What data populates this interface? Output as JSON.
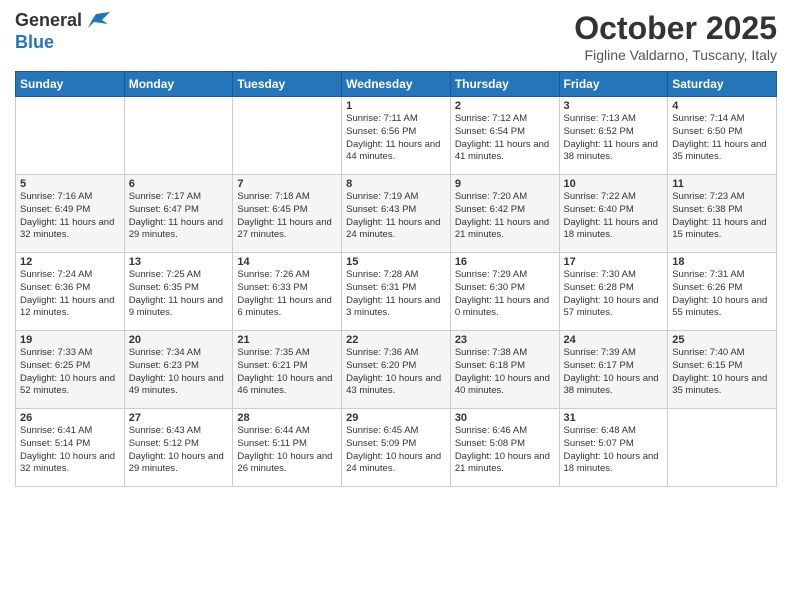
{
  "header": {
    "logo_line1": "General",
    "logo_line2": "Blue",
    "month_title": "October 2025",
    "location": "Figline Valdarno, Tuscany, Italy"
  },
  "days_of_week": [
    "Sunday",
    "Monday",
    "Tuesday",
    "Wednesday",
    "Thursday",
    "Friday",
    "Saturday"
  ],
  "weeks": [
    {
      "days": [
        {
          "num": "",
          "content": ""
        },
        {
          "num": "",
          "content": ""
        },
        {
          "num": "",
          "content": ""
        },
        {
          "num": "1",
          "content": "Sunrise: 7:11 AM\nSunset: 6:56 PM\nDaylight: 11 hours and 44 minutes."
        },
        {
          "num": "2",
          "content": "Sunrise: 7:12 AM\nSunset: 6:54 PM\nDaylight: 11 hours and 41 minutes."
        },
        {
          "num": "3",
          "content": "Sunrise: 7:13 AM\nSunset: 6:52 PM\nDaylight: 11 hours and 38 minutes."
        },
        {
          "num": "4",
          "content": "Sunrise: 7:14 AM\nSunset: 6:50 PM\nDaylight: 11 hours and 35 minutes."
        }
      ]
    },
    {
      "days": [
        {
          "num": "5",
          "content": "Sunrise: 7:16 AM\nSunset: 6:49 PM\nDaylight: 11 hours and 32 minutes."
        },
        {
          "num": "6",
          "content": "Sunrise: 7:17 AM\nSunset: 6:47 PM\nDaylight: 11 hours and 29 minutes."
        },
        {
          "num": "7",
          "content": "Sunrise: 7:18 AM\nSunset: 6:45 PM\nDaylight: 11 hours and 27 minutes."
        },
        {
          "num": "8",
          "content": "Sunrise: 7:19 AM\nSunset: 6:43 PM\nDaylight: 11 hours and 24 minutes."
        },
        {
          "num": "9",
          "content": "Sunrise: 7:20 AM\nSunset: 6:42 PM\nDaylight: 11 hours and 21 minutes."
        },
        {
          "num": "10",
          "content": "Sunrise: 7:22 AM\nSunset: 6:40 PM\nDaylight: 11 hours and 18 minutes."
        },
        {
          "num": "11",
          "content": "Sunrise: 7:23 AM\nSunset: 6:38 PM\nDaylight: 11 hours and 15 minutes."
        }
      ]
    },
    {
      "days": [
        {
          "num": "12",
          "content": "Sunrise: 7:24 AM\nSunset: 6:36 PM\nDaylight: 11 hours and 12 minutes."
        },
        {
          "num": "13",
          "content": "Sunrise: 7:25 AM\nSunset: 6:35 PM\nDaylight: 11 hours and 9 minutes."
        },
        {
          "num": "14",
          "content": "Sunrise: 7:26 AM\nSunset: 6:33 PM\nDaylight: 11 hours and 6 minutes."
        },
        {
          "num": "15",
          "content": "Sunrise: 7:28 AM\nSunset: 6:31 PM\nDaylight: 11 hours and 3 minutes."
        },
        {
          "num": "16",
          "content": "Sunrise: 7:29 AM\nSunset: 6:30 PM\nDaylight: 11 hours and 0 minutes."
        },
        {
          "num": "17",
          "content": "Sunrise: 7:30 AM\nSunset: 6:28 PM\nDaylight: 10 hours and 57 minutes."
        },
        {
          "num": "18",
          "content": "Sunrise: 7:31 AM\nSunset: 6:26 PM\nDaylight: 10 hours and 55 minutes."
        }
      ]
    },
    {
      "days": [
        {
          "num": "19",
          "content": "Sunrise: 7:33 AM\nSunset: 6:25 PM\nDaylight: 10 hours and 52 minutes."
        },
        {
          "num": "20",
          "content": "Sunrise: 7:34 AM\nSunset: 6:23 PM\nDaylight: 10 hours and 49 minutes."
        },
        {
          "num": "21",
          "content": "Sunrise: 7:35 AM\nSunset: 6:21 PM\nDaylight: 10 hours and 46 minutes."
        },
        {
          "num": "22",
          "content": "Sunrise: 7:36 AM\nSunset: 6:20 PM\nDaylight: 10 hours and 43 minutes."
        },
        {
          "num": "23",
          "content": "Sunrise: 7:38 AM\nSunset: 6:18 PM\nDaylight: 10 hours and 40 minutes."
        },
        {
          "num": "24",
          "content": "Sunrise: 7:39 AM\nSunset: 6:17 PM\nDaylight: 10 hours and 38 minutes."
        },
        {
          "num": "25",
          "content": "Sunrise: 7:40 AM\nSunset: 6:15 PM\nDaylight: 10 hours and 35 minutes."
        }
      ]
    },
    {
      "days": [
        {
          "num": "26",
          "content": "Sunrise: 6:41 AM\nSunset: 5:14 PM\nDaylight: 10 hours and 32 minutes."
        },
        {
          "num": "27",
          "content": "Sunrise: 6:43 AM\nSunset: 5:12 PM\nDaylight: 10 hours and 29 minutes."
        },
        {
          "num": "28",
          "content": "Sunrise: 6:44 AM\nSunset: 5:11 PM\nDaylight: 10 hours and 26 minutes."
        },
        {
          "num": "29",
          "content": "Sunrise: 6:45 AM\nSunset: 5:09 PM\nDaylight: 10 hours and 24 minutes."
        },
        {
          "num": "30",
          "content": "Sunrise: 6:46 AM\nSunset: 5:08 PM\nDaylight: 10 hours and 21 minutes."
        },
        {
          "num": "31",
          "content": "Sunrise: 6:48 AM\nSunset: 5:07 PM\nDaylight: 10 hours and 18 minutes."
        },
        {
          "num": "",
          "content": ""
        }
      ]
    }
  ]
}
